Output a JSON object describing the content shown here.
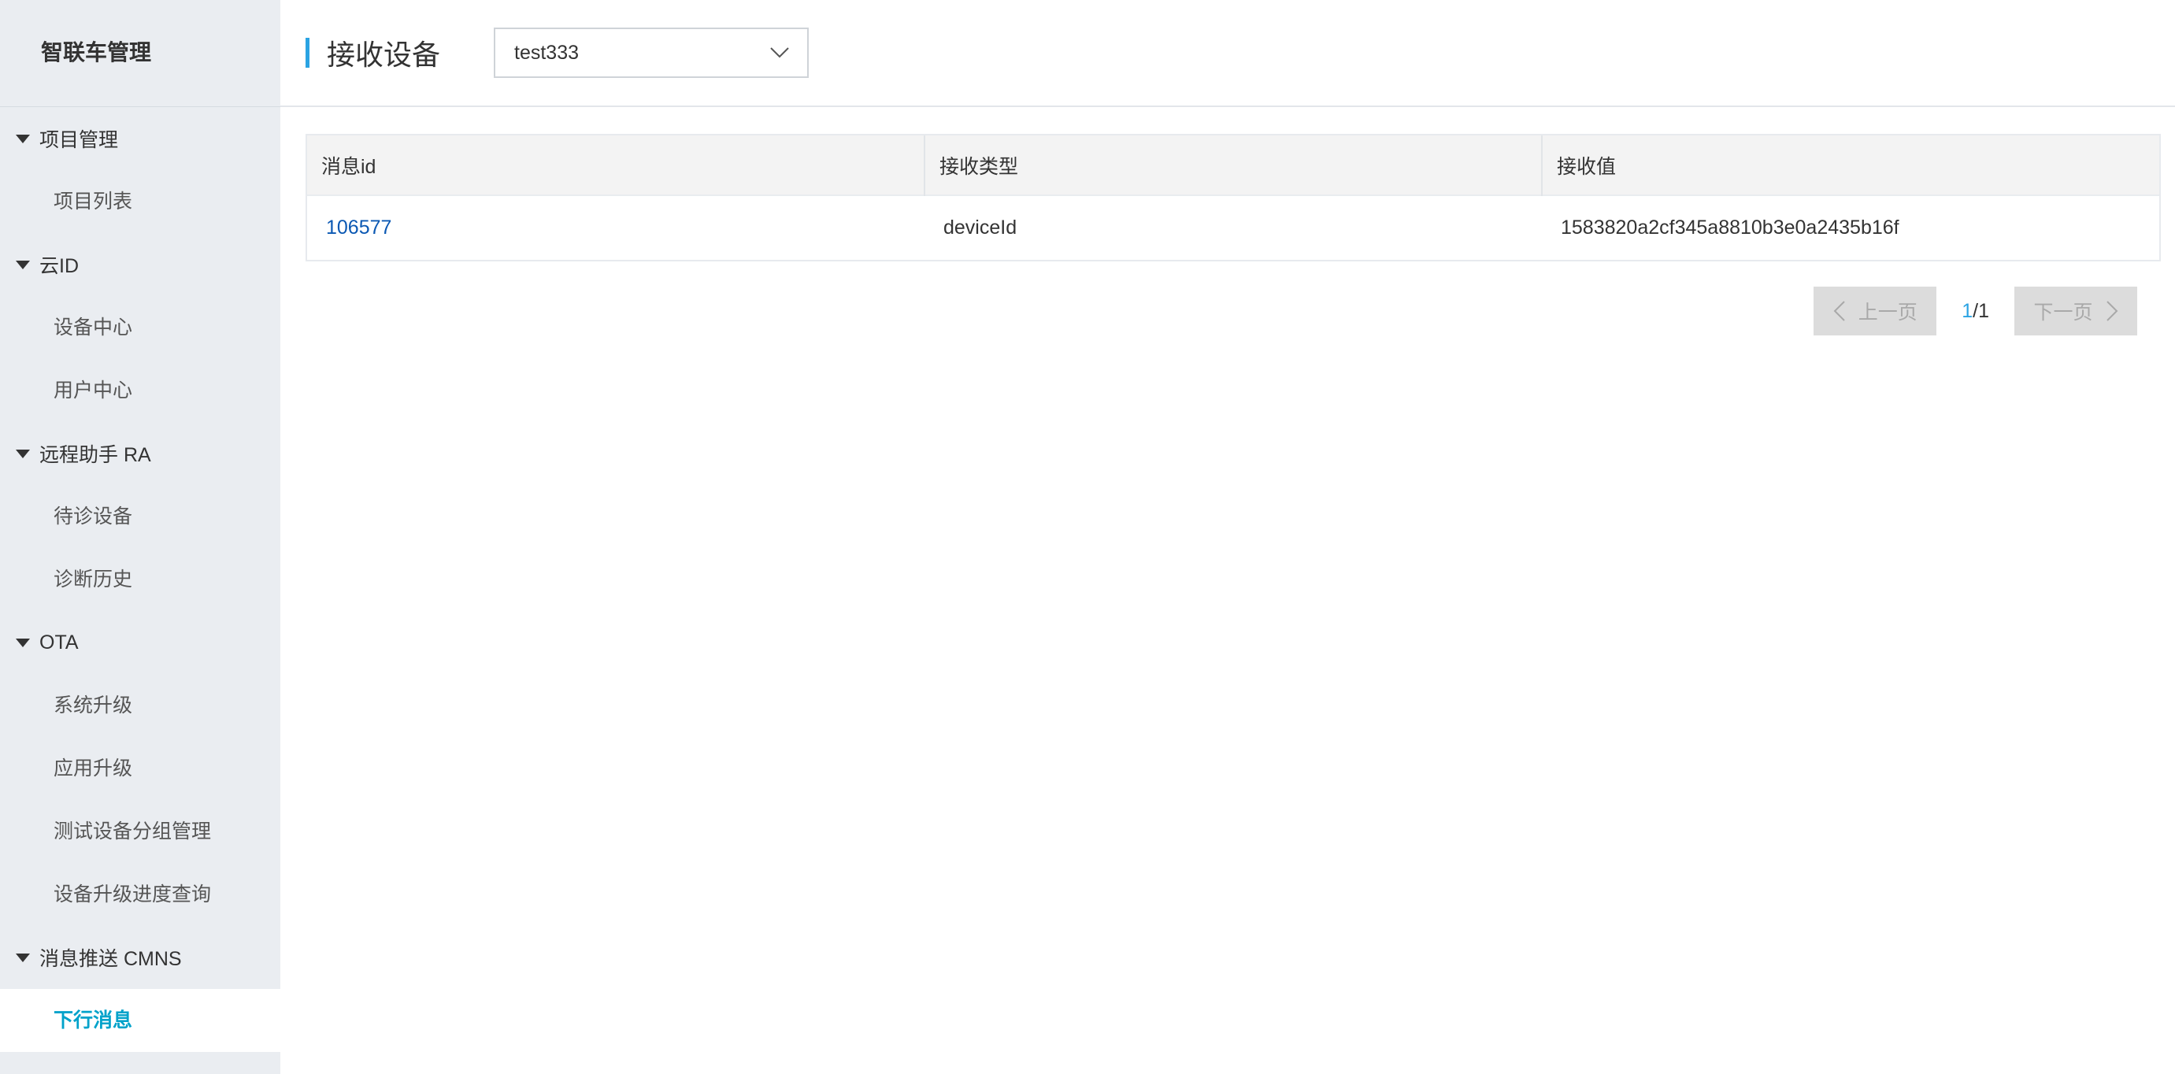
{
  "sidebar": {
    "title": "智联车管理",
    "groups": [
      {
        "label": "项目管理",
        "items": [
          {
            "label": "项目列表"
          }
        ]
      },
      {
        "label": "云ID",
        "items": [
          {
            "label": "设备中心"
          },
          {
            "label": "用户中心"
          }
        ]
      },
      {
        "label": "远程助手 RA",
        "items": [
          {
            "label": "待诊设备"
          },
          {
            "label": "诊断历史"
          }
        ]
      },
      {
        "label": "OTA",
        "items": [
          {
            "label": "系统升级"
          },
          {
            "label": "应用升级"
          },
          {
            "label": "测试设备分组管理"
          },
          {
            "label": "设备升级进度查询"
          }
        ]
      },
      {
        "label": "消息推送 CMNS",
        "items": [
          {
            "label": "下行消息",
            "active": true
          }
        ]
      }
    ]
  },
  "header": {
    "title": "接收设备",
    "select_value": "test333"
  },
  "table": {
    "columns": [
      "消息id",
      "接收类型",
      "接收值"
    ],
    "rows": [
      {
        "id": "106577",
        "type": "deviceId",
        "value": "1583820a2cf345a8810b3e0a2435b16f"
      }
    ]
  },
  "pager": {
    "prev_label": "上一页",
    "next_label": "下一页",
    "current": "1",
    "total": "/1"
  },
  "colors": {
    "accent": "#2aa3e3",
    "active_nav": "#00a2ca",
    "link": "#0b58b3",
    "sidebar_bg": "#eaedf1"
  }
}
